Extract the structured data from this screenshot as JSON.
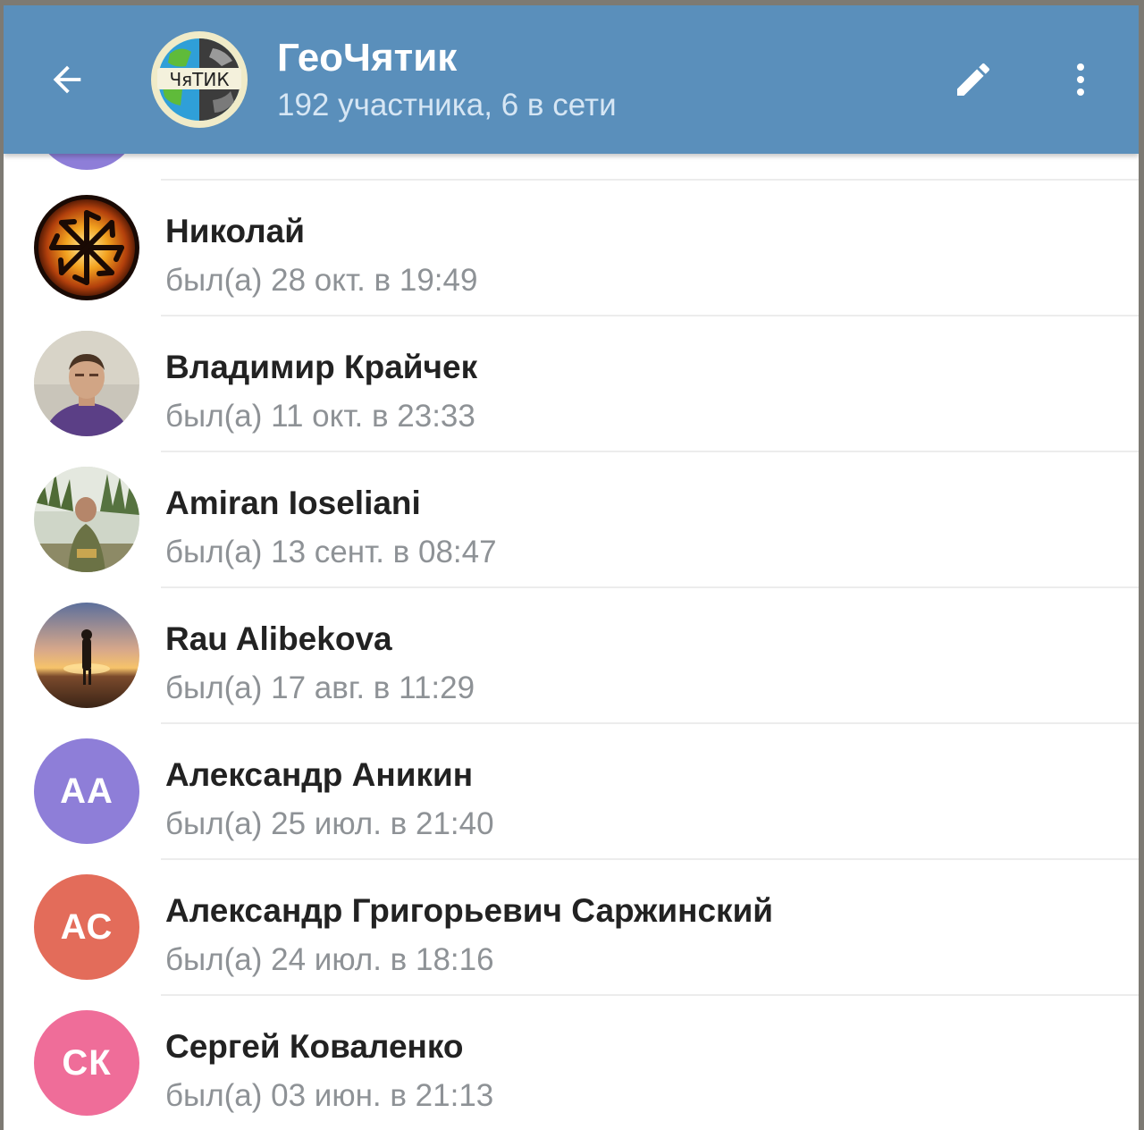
{
  "header": {
    "title": "ГеоЧятик",
    "subtitle": "192 участника, 6 в сети",
    "group_avatar_logo_text": "ЧяТИК",
    "background_color": "#5a8fbb"
  },
  "icons": {
    "back": "arrow-left-icon",
    "edit": "pencil-icon",
    "more": "more-vertical-icon"
  },
  "members": [
    {
      "name": "Николай",
      "status": "был(а) 28 окт. в 19:49",
      "avatar": "photo"
    },
    {
      "name": "Владимир Крайчек",
      "status": "был(а) 11 окт. в 23:33",
      "avatar": "photo"
    },
    {
      "name": "Amiran Ioseliani",
      "status": "был(а) 13 сент. в 08:47",
      "avatar": "photo"
    },
    {
      "name": "Rau Alibekova",
      "status": "был(а) 17 авг. в 11:29",
      "avatar": "photo"
    },
    {
      "name": "Александр Аникин",
      "status": "был(а) 25 июл. в 21:40",
      "avatar": "initials",
      "initials": "АА",
      "color": "#8e7ed8"
    },
    {
      "name": "Александр Григорьевич Саржинский",
      "status": "был(а) 24 июл. в 18:16",
      "avatar": "initials",
      "initials": "АС",
      "color": "#e36c5a"
    },
    {
      "name": "Сергей Коваленко",
      "status": "был(а) 03 июн. в 21:13",
      "avatar": "initials",
      "initials": "СК",
      "color": "#ef6d99"
    }
  ]
}
